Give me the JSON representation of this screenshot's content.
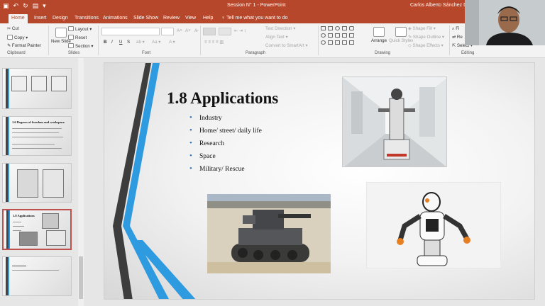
{
  "window": {
    "title": "Session N° 1  -  PowerPoint",
    "user": "Carlos Alberto Sánchez Delg"
  },
  "tabs": [
    "Home",
    "Insert",
    "Design",
    "Transitions",
    "Animations",
    "Slide Show",
    "Review",
    "View",
    "Help"
  ],
  "tell_me": "Tell me what you want to do",
  "ribbon": {
    "clipboard": {
      "label": "Clipboard",
      "cut": "Cut",
      "copy": "Copy",
      "format_painter": "Format Painter"
    },
    "slides": {
      "label": "Slides",
      "new_slide": "New Slide",
      "layout": "Layout",
      "reset": "Reset",
      "section": "Section"
    },
    "font": {
      "label": "Font",
      "bold": "B",
      "italic": "I",
      "underline": "U",
      "strike": "S",
      "size_value": ""
    },
    "paragraph": {
      "label": "Paragraph",
      "text_direction": "Text Direction",
      "align_text": "Align Text",
      "convert_smartart": "Convert to SmartArt"
    },
    "drawing": {
      "label": "Drawing",
      "arrange": "Arrange",
      "quick_styles": "Quick Styles",
      "shape_fill": "Shape Fill",
      "shape_outline": "Shape Outline",
      "shape_effects": "Shape Effects"
    },
    "editing": {
      "label": "Editing",
      "find": "Fi",
      "replace": "Re",
      "select": "Select"
    }
  },
  "thumbnails": [
    {
      "title": ""
    },
    {
      "title": "1.6 Degrees of freedom and workspace"
    },
    {
      "title": ""
    },
    {
      "title": "1.8 Applications"
    },
    {
      "title": ""
    }
  ],
  "slide": {
    "title": "1.8 Applications",
    "bullets": [
      "Industry",
      "Home/ street/ daily life",
      "Research",
      "Space",
      "Military/ Rescue"
    ]
  },
  "colors": {
    "accent": "#b7472a",
    "bullet": "#2e75b6",
    "slide_stripe_blue": "#2e9be0",
    "slide_stripe_dark": "#444444"
  }
}
